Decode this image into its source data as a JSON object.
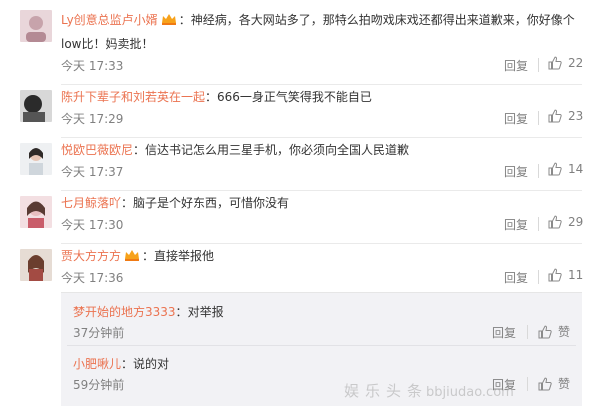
{
  "comments": [
    {
      "user": "Ly创意总监卢小婿",
      "vip": true,
      "text": "神经病，各大网站多了，那特么拍吻戏床戏还都得出来道歉来，你好像个",
      "text2": "low比！妈卖批！",
      "time": "今天 17:33",
      "reply_label": "回复",
      "likes": "22"
    },
    {
      "user": "陈升下辈子和刘若英在一起",
      "vip": false,
      "text": "666一身正气笑得我不能自已",
      "time": "今天 17:29",
      "reply_label": "回复",
      "likes": "23"
    },
    {
      "user": "悦欧巴薇欧尼",
      "vip": false,
      "text": "信达书记怎么用三星手机，你必须向全国人民道歉",
      "time": "今天 17:37",
      "reply_label": "回复",
      "likes": "14"
    },
    {
      "user": "七月鲸落吖",
      "vip": false,
      "text": "脑子是个好东西，可惜你没有",
      "time": "今天 17:30",
      "reply_label": "回复",
      "likes": "29"
    },
    {
      "user": "贾大方方方",
      "vip": true,
      "text": "直接举报他",
      "time": "今天 17:36",
      "reply_label": "回复",
      "likes": "11"
    }
  ],
  "sub_replies": [
    {
      "user": "梦开始的地方3333",
      "text": "对举报",
      "time": "37分钟前",
      "reply_label": "回复",
      "like_label": "赞"
    },
    {
      "user": "小肥啾儿",
      "text": "说的对",
      "time": "59分钟前",
      "reply_label": "回复",
      "like_label": "赞"
    }
  ],
  "watermark": {
    "text": "娱乐头条",
    "site": "bbjiudao.com"
  },
  "colors": {
    "username": "#eb7350",
    "meta": "#808080",
    "text": "#333333",
    "sub_bg": "#f2f2f5"
  },
  "icons": {
    "vip_badge": "vip-badge-icon",
    "like": "thumbs-up-icon"
  }
}
